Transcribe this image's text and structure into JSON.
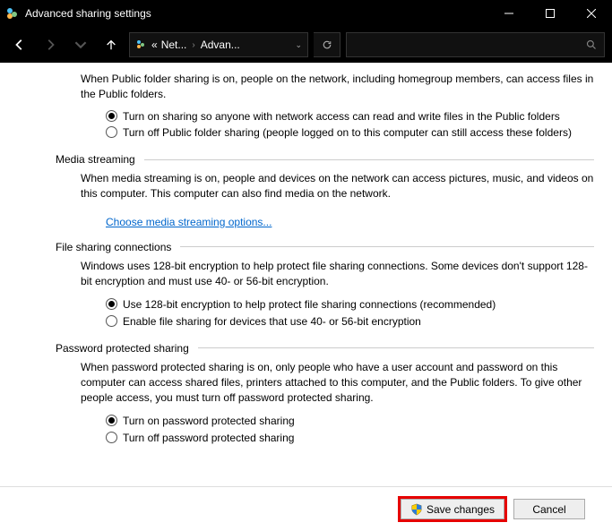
{
  "window": {
    "title": "Advanced sharing settings"
  },
  "breadcrumb": {
    "prefix": "«",
    "seg1": "Net...",
    "seg2": "Advan..."
  },
  "publicFolder": {
    "desc": "When Public folder sharing is on, people on the network, including homegroup members, can access files in the Public folders.",
    "opt1": "Turn on sharing so anyone with network access can read and write files in the Public folders",
    "opt2": "Turn off Public folder sharing (people logged on to this computer can still access these folders)"
  },
  "media": {
    "title": "Media streaming",
    "desc": "When media streaming is on, people and devices on the network can access pictures, music, and videos on this computer. This computer can also find media on the network.",
    "link": "Choose media streaming options..."
  },
  "fileSharing": {
    "title": "File sharing connections",
    "desc": "Windows uses 128-bit encryption to help protect file sharing connections. Some devices don't support 128-bit encryption and must use 40- or 56-bit encryption.",
    "opt1": "Use 128-bit encryption to help protect file sharing connections (recommended)",
    "opt2": "Enable file sharing for devices that use 40- or 56-bit encryption"
  },
  "password": {
    "title": "Password protected sharing",
    "desc": "When password protected sharing is on, only people who have a user account and password on this computer can access shared files, printers attached to this computer, and the Public folders. To give other people access, you must turn off password protected sharing.",
    "opt1": "Turn on password protected sharing",
    "opt2": "Turn off password protected sharing"
  },
  "buttons": {
    "save": "Save changes",
    "cancel": "Cancel"
  }
}
